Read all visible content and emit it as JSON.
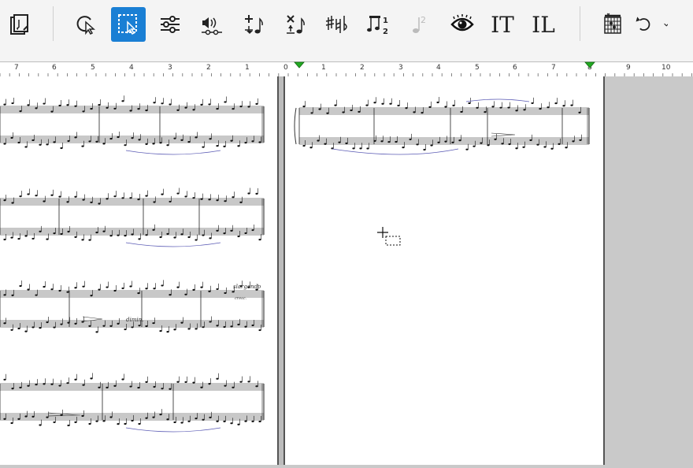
{
  "toolbar": {
    "buttons": [
      {
        "name": "score-properties",
        "icon": "score-document-icon"
      },
      {
        "name": "select",
        "icon": "pointer-icon"
      },
      {
        "name": "range-select",
        "icon": "range-select-icon",
        "active": true
      },
      {
        "name": "mixer",
        "icon": "sliders-icon"
      },
      {
        "name": "playback",
        "icon": "speaker-icon"
      },
      {
        "name": "add-note",
        "icon": "plus-note-icon"
      },
      {
        "name": "delete-note",
        "icon": "x-note-icon"
      },
      {
        "name": "accidentals",
        "icon": "sharp-natural-flat-icon"
      },
      {
        "name": "tuplets",
        "icon": "tuplet-icon"
      },
      {
        "name": "voice-two",
        "icon": "voice-note-icon",
        "disabled": true
      },
      {
        "name": "view",
        "icon": "eye-icon"
      },
      {
        "name": "text-insert",
        "icon": "text-cursor-icon",
        "label": "IT"
      },
      {
        "name": "lyrics-insert",
        "icon": "lyrics-cursor-icon",
        "label": "IL"
      },
      {
        "name": "chord-diagram",
        "icon": "chord-grid-icon"
      },
      {
        "name": "undo",
        "icon": "undo-icon"
      }
    ]
  },
  "ruler": {
    "left_numbers": [
      "7",
      "6",
      "5",
      "4",
      "3",
      "2",
      "1"
    ],
    "right_numbers": [
      "0",
      "1",
      "2",
      "3",
      "4",
      "5",
      "6",
      "7",
      "8",
      "9",
      "10"
    ]
  },
  "score": {
    "left_page_markings": {
      "slargando": "slargando",
      "cresc": "cresc.",
      "dimin": "dimin."
    }
  },
  "colors": {
    "accent": "#1a7fd4",
    "ruler_marker": "#22aa22",
    "slur": "#5a5ab4"
  }
}
